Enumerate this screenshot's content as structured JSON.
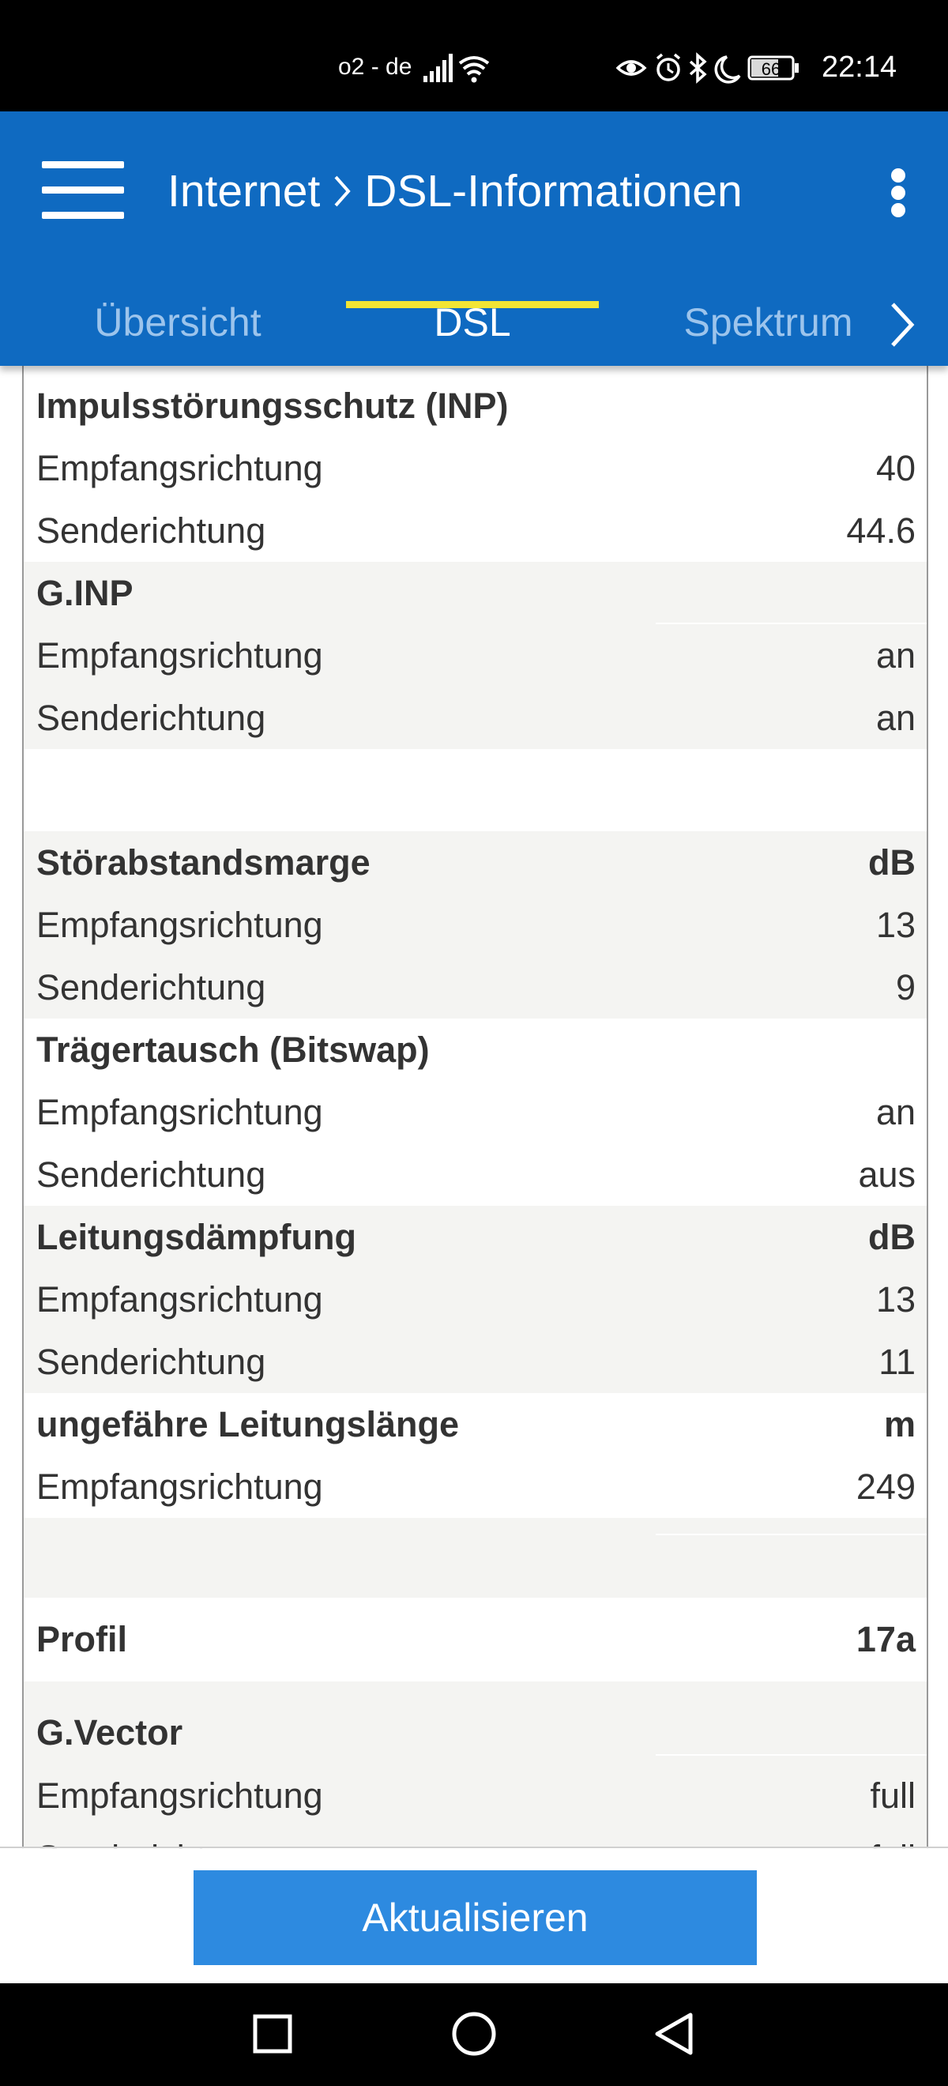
{
  "status_bar": {
    "carrier": "o2 - de",
    "battery": "66",
    "time": "22:14",
    "icons": [
      "signal-icon",
      "wifi-icon",
      "eye-icon",
      "alarm-icon",
      "bluetooth-icon",
      "moon-icon",
      "battery-icon"
    ]
  },
  "header": {
    "crumb_parent": "Internet",
    "crumb_current": "DSL-Informationen",
    "background_color": "#0f6ac1"
  },
  "tabs": [
    {
      "label": "Übersicht",
      "active": false
    },
    {
      "label": "DSL",
      "active": true
    },
    {
      "label": "Spektrum",
      "active": false
    }
  ],
  "table": {
    "inp": {
      "title": "Impulsstörungsschutz (INP)",
      "rx_label": "Empfangsrichtung",
      "rx_value": "40",
      "tx_label": "Senderichtung",
      "tx_value": "44.6"
    },
    "ginp": {
      "title": "G.INP",
      "rx_label": "Empfangsrichtung",
      "rx_value": "an",
      "tx_label": "Senderichtung",
      "tx_value": "an"
    },
    "snr": {
      "title": "Störabstandsmarge",
      "unit": "dB",
      "rx_label": "Empfangsrichtung",
      "rx_value": "13",
      "tx_label": "Senderichtung",
      "tx_value": "9"
    },
    "bitswap": {
      "title": "Trägertausch (Bitswap)",
      "rx_label": "Empfangsrichtung",
      "rx_value": "an",
      "tx_label": "Senderichtung",
      "tx_value": "aus"
    },
    "attenuation": {
      "title": "Leitungsdämpfung",
      "unit": "dB",
      "rx_label": "Empfangsrichtung",
      "rx_value": "13",
      "tx_label": "Senderichtung",
      "tx_value": "11"
    },
    "length": {
      "title": "ungefähre Leitungslänge",
      "unit": "m",
      "rx_label": "Empfangsrichtung",
      "rx_value": "249"
    },
    "profile": {
      "title": "Profil",
      "value": "17a"
    },
    "vector": {
      "title": "G.Vector",
      "rx_label": "Empfangsrichtung",
      "rx_value": "full",
      "tx_label": "Senderichtung",
      "tx_value": "full"
    }
  },
  "footer": {
    "refresh_label": "Aktualisieren",
    "button_color": "#2d8ae0"
  },
  "nav_bar": {
    "buttons": [
      "recent-apps-icon",
      "home-icon",
      "back-icon"
    ]
  }
}
